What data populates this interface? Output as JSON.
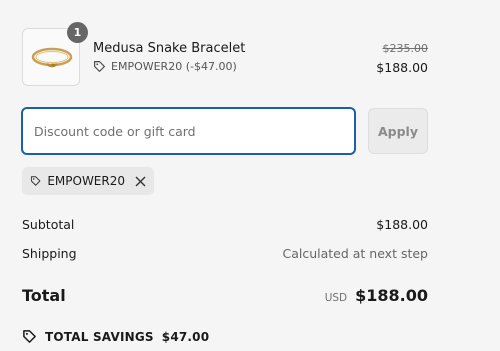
{
  "product": {
    "quantity": "1",
    "name": "Medusa Snake Bracelet",
    "discount_line": "EMPOWER20 (-$47.00)",
    "original_price": "$235.00",
    "price": "$188.00",
    "image_icon": "bracelet-image"
  },
  "discount": {
    "placeholder": "Discount code or gift card",
    "value": "",
    "apply_label": "Apply",
    "applied_code": "EMPOWER20"
  },
  "summary": {
    "subtotal_label": "Subtotal",
    "subtotal_value": "$188.00",
    "shipping_label": "Shipping",
    "shipping_value": "Calculated at next step",
    "total_label": "Total",
    "currency": "USD",
    "total_value": "$188.00",
    "savings_label": "TOTAL SAVINGS",
    "savings_value": "$47.00"
  },
  "colors": {
    "focus_border": "#1c5ea8",
    "badge_bg": "#666666",
    "page_bg": "#f5f5f5"
  }
}
